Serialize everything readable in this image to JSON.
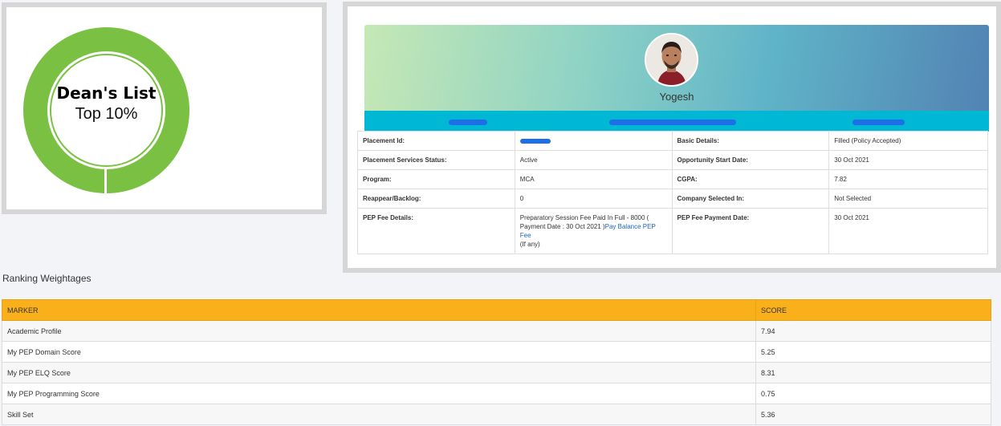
{
  "deans_list": {
    "title": "Dean's List",
    "subtitle": "Top 10%",
    "ring_color": "#7ac143"
  },
  "profile": {
    "name": "Yogesh",
    "banner_strip_color": "#00b7d4",
    "details": [
      {
        "label": "Placement Id:",
        "value": "",
        "label2": "Basic Details:",
        "value2": "Filled (Policy Accepted)"
      },
      {
        "label": "Placement Services Status:",
        "value": "Active",
        "label2": "Opportunity Start Date:",
        "value2": "30 Oct 2021"
      },
      {
        "label": "Program:",
        "value": "MCA",
        "label2": "CGPA:",
        "value2": "7.82"
      },
      {
        "label": "Reappear/Backlog:",
        "value": "0",
        "label2": "Company Selected In:",
        "value2": "Not Selected"
      },
      {
        "label": "PEP Fee Details:",
        "value": "Preparatory Session Fee Paid In Full - 8000 ( Payment Date : 30 Oct 2021 )",
        "link": "Pay Balance PEP Fee",
        "value_suffix": "(If any)",
        "label2": "PEP Fee Payment Date:",
        "value2": "30 Oct 2021"
      }
    ]
  },
  "ranking": {
    "title": "Ranking Weightages",
    "header_color": "#fab01a",
    "columns": [
      "MARKER",
      "SCORE"
    ],
    "rows": [
      {
        "marker": "Academic Profile",
        "score": "7.94"
      },
      {
        "marker": "My PEP Domain Score",
        "score": "5.25"
      },
      {
        "marker": "My PEP ELQ Score",
        "score": "8.31"
      },
      {
        "marker": "My PEP Programming Score",
        "score": "0.75"
      },
      {
        "marker": "Skill Set",
        "score": "5.36"
      }
    ]
  }
}
